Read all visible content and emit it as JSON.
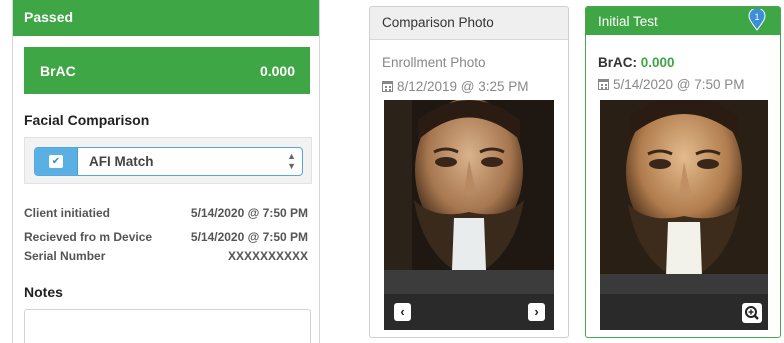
{
  "left": {
    "header": "Passed",
    "brac_label": "BrAC",
    "brac_value": "0.000",
    "facial_title": "Facial Comparison",
    "afi_label": "AFI Match",
    "rows": [
      {
        "key": "Client initiatied",
        "value": "5/14/2020 @ 7:50 PM"
      },
      {
        "key": "Recieved fro m Device",
        "value": "5/14/2020 @ 7:50 PM"
      },
      {
        "key": "Serial Number",
        "value": "XXXXXXXXXX"
      }
    ],
    "notes_title": "Notes"
  },
  "comparison": {
    "header": "Comparison Photo",
    "subtitle": "Enrollment Photo",
    "date": "8/12/2019 @ 3:25 PM"
  },
  "initial": {
    "header": "Initial Test",
    "pin_number": "1",
    "brac_label": "BrAC:",
    "brac_value": "0.000",
    "date": "5/14/2020 @ 7:50 PM"
  },
  "icons": [
    "checkbox-icon",
    "select-arrows-icon",
    "calendar-icon",
    "chevron-left-icon",
    "chevron-right-icon",
    "map-pin-icon",
    "zoom-in-icon"
  ],
  "colors": {
    "success": "#3fa645",
    "info": "#5ab0e3",
    "pin": "#3b8fd9"
  }
}
